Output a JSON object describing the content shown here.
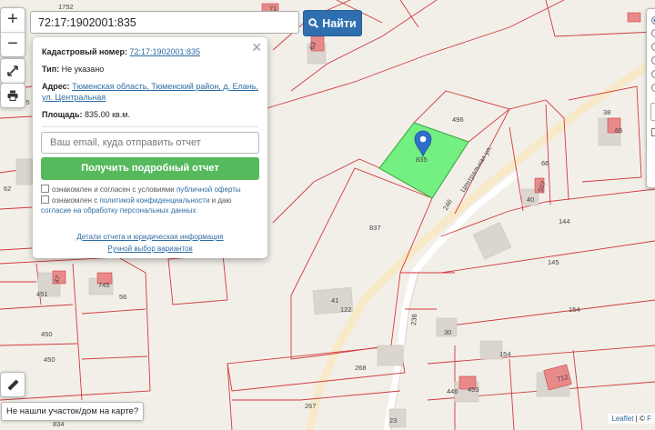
{
  "search": {
    "value": "72:17:1902001:835",
    "find_label": "Найти"
  },
  "zoom": {
    "in": "+",
    "out": "−"
  },
  "popup": {
    "cadastral_label": "Кадастровый номер:",
    "cadastral_value": "72:17:1902001:835",
    "type_label": "Тип:",
    "type_value": "Не указано",
    "address_label": "Адрес:",
    "address_value": "Тюменская область, Тюменский район, д. Елань, ул. Центральная",
    "area_label": "Площадь:",
    "area_value": "835.00 кв.м.",
    "email_placeholder": "Ваш email, куда отправить отчет",
    "get_report": "Получить подробный отчет",
    "check1_text": "ознакомлен и согласен с условиями",
    "check1_link": "публичной оферты",
    "check2_text": "ознакомлен с",
    "check2_link1": "политикой конфиденциальности",
    "check2_mid": "и даю",
    "check2_link2": "согласие на обработку персональных данных",
    "link_details": "Детали отчета и юридическая информация",
    "link_manual": "Ручной выбор вариантов"
  },
  "not_found": "Не нашли участок/дом на карте?",
  "attribution": {
    "leaflet": "Leaflet",
    "sep": "| ©",
    "more": "F"
  },
  "map_labels": {
    "p835": "835",
    "p496": "496",
    "p66": "66",
    "p38": "38",
    "p65": "65",
    "p40": "40",
    "p507": "507",
    "p144": "144",
    "p145": "145",
    "p154": "154",
    "p837": "837",
    "p246": "246",
    "p122": "122",
    "p41": "41",
    "p238": "238",
    "p30": "30",
    "p154b": "154",
    "p268": "268",
    "p267": "267",
    "p23": "23",
    "p446": "446",
    "p453": "453",
    "p712": "712",
    "p451": "451",
    "p47": "47",
    "p745": "745",
    "p56": "56",
    "p450": "450",
    "p450b": "450",
    "p834": "834",
    "p62": "62",
    "p1745": "1745",
    "p1752": "1752",
    "p63": "63",
    "p71": "71",
    "street": "Центральная ул."
  },
  "colors": {
    "parcel_line": "#d23a3a",
    "selected_fill": "#66ee77",
    "marker": "#2f6fc7",
    "button_green": "#56b95d",
    "button_blue": "#2f6fb0"
  }
}
